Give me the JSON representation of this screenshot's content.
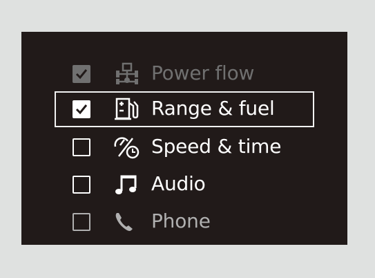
{
  "menu": {
    "items": [
      {
        "label": "Power flow",
        "icon": "power-flow-icon",
        "checked": true,
        "state": "disabled"
      },
      {
        "label": "Range & fuel",
        "icon": "fuel-pump-icon",
        "checked": true,
        "state": "selected"
      },
      {
        "label": "Speed & time",
        "icon": "speed-time-icon",
        "checked": false,
        "state": "normal"
      },
      {
        "label": "Audio",
        "icon": "music-note-icon",
        "checked": false,
        "state": "normal"
      },
      {
        "label": "Phone",
        "icon": "phone-icon",
        "checked": false,
        "state": "partial"
      }
    ]
  },
  "colors": {
    "screen_bg": "#211a19",
    "text": "#ffffff",
    "disabled": "#707070",
    "outer_bg": "#dfe1e0"
  }
}
